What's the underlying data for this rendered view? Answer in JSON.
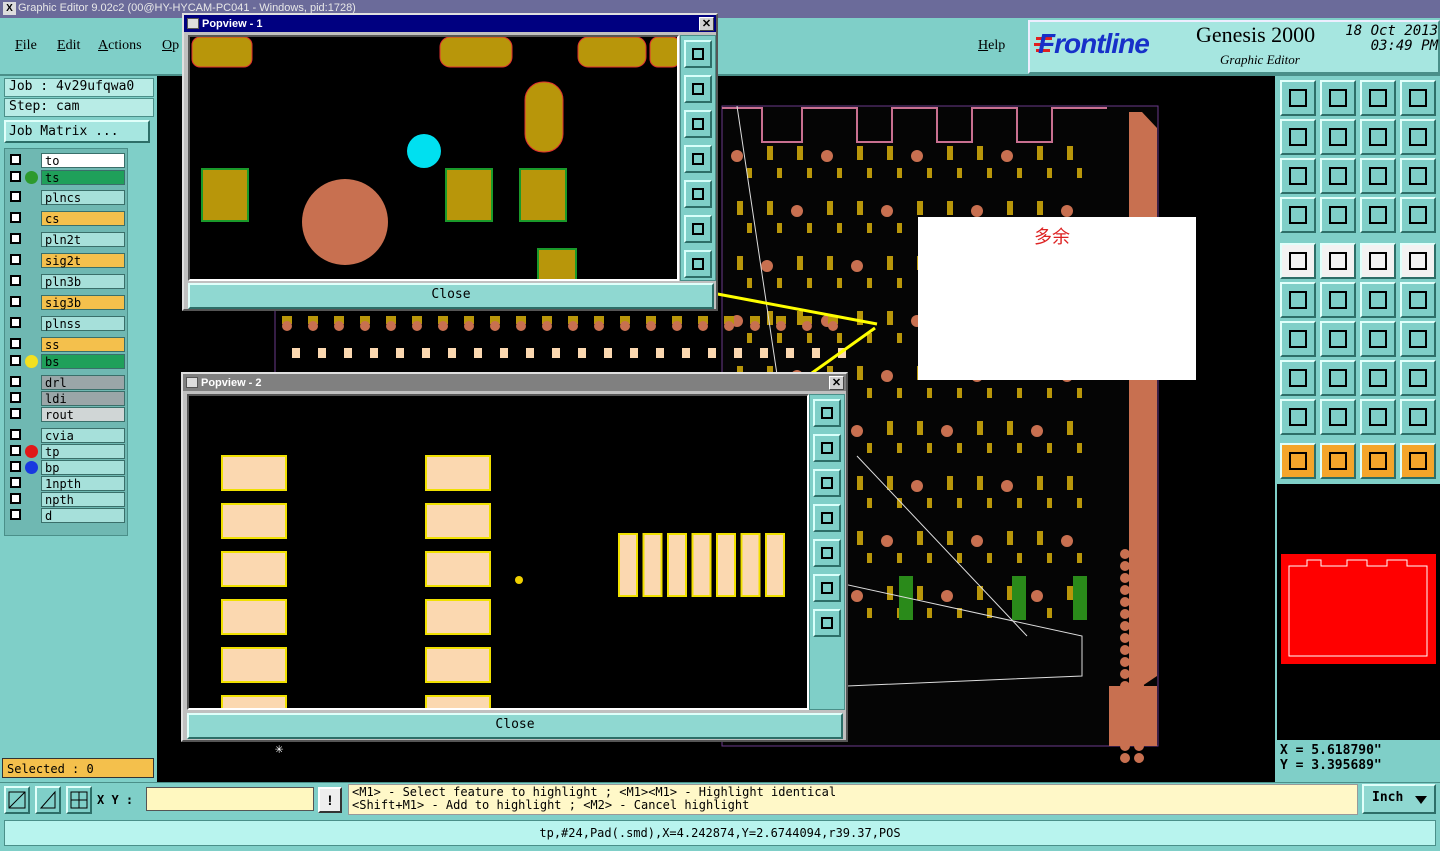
{
  "window": {
    "title": "Graphic Editor 9.02c2 (00@HY-HYCAM-PC041 - Windows, pid:1728)"
  },
  "menu": {
    "file": "File",
    "edit": "Edit",
    "actions": "Actions",
    "options": "Op",
    "help": "Help"
  },
  "logo": {
    "brand": "Frontline",
    "product": "Genesis 2000",
    "subtitle": "Graphic Editor",
    "date": "18 Oct 2013",
    "time": "03:49 PM"
  },
  "job": {
    "job_label": "Job : 4v29ufqwa0",
    "step_label": "Step: cam",
    "matrix_button": "Job Matrix ..."
  },
  "layers": [
    {
      "name": "to",
      "color": "#ffffff",
      "dot": ""
    },
    {
      "name": "ts",
      "color": "#1fa05a",
      "dot": "#2d9a2d"
    },
    {
      "name": "plncs",
      "color": "#a6e0da",
      "dot": ""
    },
    {
      "name": "cs",
      "color": "#f4c04c",
      "dot": ""
    },
    {
      "name": "pln2t",
      "color": "#a6e0da",
      "dot": ""
    },
    {
      "name": "sig2t",
      "color": "#f4c04c",
      "dot": ""
    },
    {
      "name": "pln3b",
      "color": "#a6e0da",
      "dot": ""
    },
    {
      "name": "sig3b",
      "color": "#f4c04c",
      "dot": ""
    },
    {
      "name": "plnss",
      "color": "#a6e0da",
      "dot": ""
    },
    {
      "name": "ss",
      "color": "#f4c04c",
      "dot": ""
    },
    {
      "name": "bs",
      "color": "#1fa05a",
      "dot": "#f4e020"
    },
    {
      "name": "drl",
      "color": "#9aa6a8",
      "dot": ""
    },
    {
      "name": "ldi",
      "color": "#9aa6a8",
      "dot": ""
    },
    {
      "name": "rout",
      "color": "#d0d6d6",
      "dot": ""
    },
    {
      "name": "cvia",
      "color": "#a6e0da",
      "dot": ""
    },
    {
      "name": "tp",
      "color": "#a6e0da",
      "dot": "#e01818"
    },
    {
      "name": "bp",
      "color": "#a6e0da",
      "dot": "#1838e0"
    },
    {
      "name": "1npth",
      "color": "#a6e0da",
      "dot": ""
    },
    {
      "name": "npth",
      "color": "#a6e0da",
      "dot": ""
    },
    {
      "name": "d",
      "color": "#a6e0da",
      "dot": ""
    }
  ],
  "selected": "Selected : 0",
  "popview1": {
    "title": "Popview - 1",
    "close": "Close"
  },
  "popview2": {
    "title": "Popview - 2",
    "close": "Close"
  },
  "annotation": "多余",
  "coords": {
    "x": "X =  5.618790\"",
    "y": "Y =  3.395689\""
  },
  "bottom": {
    "xy_label": "X Y :",
    "xy_value": "",
    "bang": "!",
    "hint1": "<M1> - Select feature to highlight ; <M1><M1> - Highlight identical",
    "hint2": "<Shift+M1> - Add to highlight ; <M2> - Cancel highlight",
    "units": "Inch"
  },
  "status": "tp,#24,Pad(.smd),X=4.242874,Y=2.6744094,r39.37,POS",
  "colors": {
    "pad": "#b8960a",
    "copper": "#c87050",
    "cyan": "#00e0f0",
    "smd": "#fbd8b0",
    "minimap": "#ff0000"
  }
}
